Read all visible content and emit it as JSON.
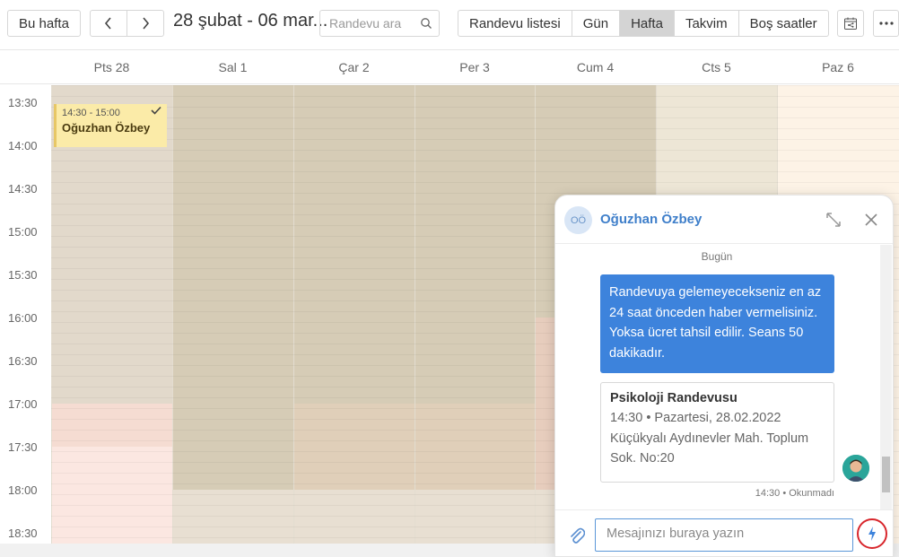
{
  "toolbar": {
    "this_week": "Bu hafta",
    "range": "28 şubat - 06 mar...",
    "search_placeholder": "Randevu ara",
    "views": [
      {
        "label": "Randevu listesi",
        "active": false
      },
      {
        "label": "Gün",
        "active": false
      },
      {
        "label": "Hafta",
        "active": true
      },
      {
        "label": "Takvim",
        "active": false
      },
      {
        "label": "Boş saatler",
        "active": false
      }
    ]
  },
  "days": [
    "Pts 28",
    "Sal 1",
    "Çar 2",
    "Per 3",
    "Cum 4",
    "Cts 5",
    "Paz 6"
  ],
  "times": [
    "13:30",
    "14:00",
    "14:30",
    "15:00",
    "15:30",
    "16:00",
    "16:30",
    "17:00",
    "17:30",
    "18:00",
    "18:30"
  ],
  "event": {
    "time": "14:30 - 15:00",
    "name": "Oğuzhan Özbey"
  },
  "chat": {
    "initials": "OÖ",
    "name": "Oğuzhan Özbey",
    "date_divider": "Bugün",
    "message": "Randevuya gelemeyecekseniz en az 24 saat önceden haber vermelisiniz. Yoksa ücret tahsil edilir. Seans 50 dakikadır.",
    "card_title": "Psikoloji Randevusu",
    "card_when": "14:30 • Pazartesi, 28.02.2022",
    "card_address": "Küçükyalı Aydınevler Mah. Toplum Sok. No:20",
    "meta": "14:30 • Okunmadı",
    "input_placeholder": "Mesajınızı buraya yazın"
  },
  "colors": {
    "accent": "#3d83dc",
    "busy": "#d9cfb9",
    "event": "#fbeba8",
    "highlight_ring": "#d8262c"
  }
}
